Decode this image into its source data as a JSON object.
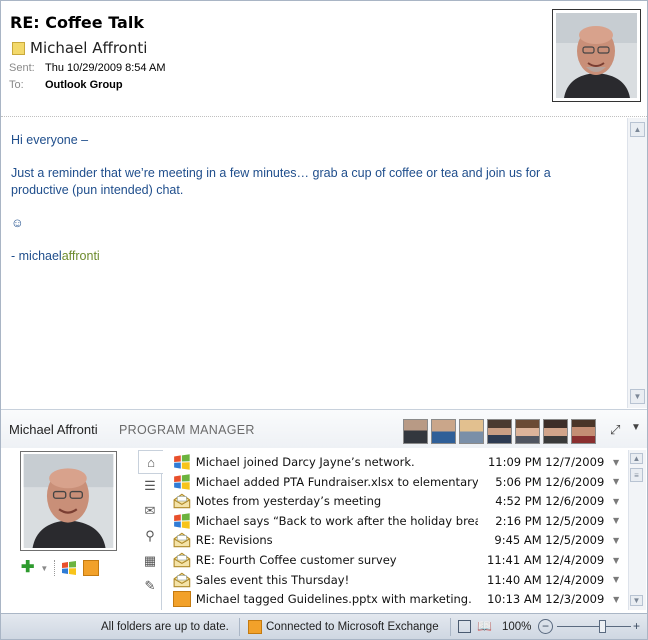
{
  "header": {
    "subject": "RE: Coffee Talk",
    "sender": "Michael Affronti",
    "sent_label": "Sent:",
    "sent_value": "Thu 10/29/2009 8:54 AM",
    "to_label": "To:",
    "to_value": "Outlook Group"
  },
  "message": {
    "greeting": "Hi everyone –",
    "paragraph": "Just a reminder that we’re meeting in a few minutes… grab a cup of coffee or tea and join us for a productive (pun intended) chat.",
    "smiley": "☺",
    "sig_prefix": "- michael",
    "sig_suffix": "affronti"
  },
  "people_pane": {
    "name": "Michael Affronti",
    "title": "PROGRAM MANAGER",
    "feed": [
      {
        "icon": "windows-live-icon",
        "text": "Michael joined Darcy Jayne’s network.",
        "time": "11:09 PM 12/7/2009"
      },
      {
        "icon": "windows-live-icon",
        "text": "Michael added PTA Fundraiser.xlsx to elementary PTA.",
        "time": "5:06 PM 12/6/2009"
      },
      {
        "icon": "mail-read-icon",
        "text": "Notes from yesterday’s meeting",
        "time": "4:52 PM 12/6/2009"
      },
      {
        "icon": "windows-live-icon",
        "text": "Michael says “Back to work after the holiday break.”.",
        "time": "2:16 PM 12/5/2009"
      },
      {
        "icon": "mail-read-icon",
        "text": "RE: Revisions",
        "time": "9:45 AM 12/5/2009"
      },
      {
        "icon": "mail-read-icon",
        "text": "RE: Fourth Coffee customer survey",
        "time": "11:41 AM 12/4/2009"
      },
      {
        "icon": "mail-read-icon",
        "text": "Sales event this Thursday!",
        "time": "11:40 AM 12/4/2009"
      },
      {
        "icon": "social-network-icon",
        "text": "Michael tagged Guidelines.pptx with marketing.",
        "time": "10:13 AM 12/3/2009"
      }
    ]
  },
  "status_bar": {
    "sync": "All folders are up to date.",
    "connection": "Connected to Microsoft Exchange",
    "zoom": "100%"
  },
  "colors": {
    "body_text": "#1f4e8c",
    "signature_accent": "#6d8b2d",
    "presence": "#f3d96b"
  }
}
